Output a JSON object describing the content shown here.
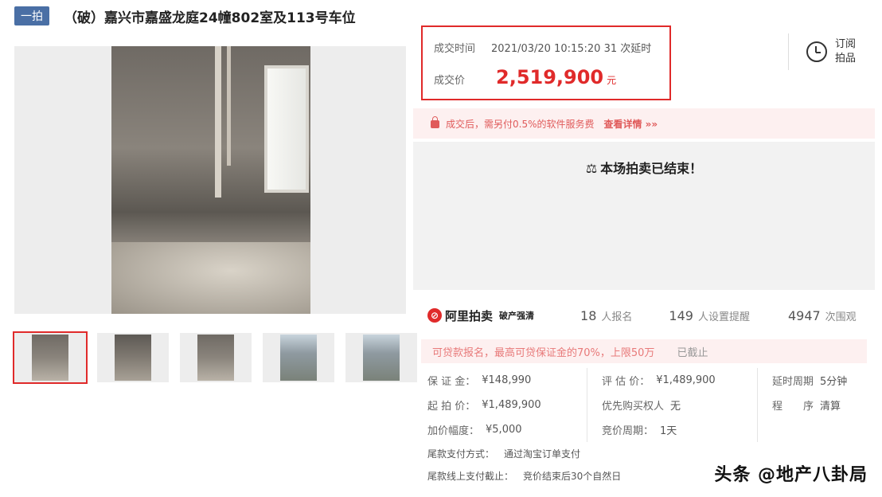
{
  "header": {
    "tag": "一拍",
    "title": "（破）嘉兴市嘉盛龙庭24幢802室及113号车位"
  },
  "deal": {
    "time_label": "成交时间",
    "time_value": "2021/03/20 10:15:20 31 次延时",
    "price_label": "成交价",
    "price_value": "2,519,900",
    "price_unit": "元"
  },
  "subscribe": {
    "label": "订阅拍品"
  },
  "notice": {
    "text": "成交后，需另付0.5%的软件服务费",
    "detail_link": "查看详情 »»"
  },
  "status": {
    "ended_text": "本场拍卖已结束！"
  },
  "brand": {
    "logo_char": "⊘",
    "name": "阿里拍卖",
    "sub": "破产强清"
  },
  "stats": {
    "signups_count": "18",
    "signups_label": "人报名",
    "reminders_count": "149",
    "reminders_label": "人设置提醒",
    "views_count": "4947",
    "views_label": "次围观"
  },
  "deposit_note": {
    "text": "可贷款报名，最高可贷保证金的70%，上限50万",
    "status": "已截止"
  },
  "info": {
    "row1": {
      "c1_label": "保 证 金：",
      "c1_value": "¥148,990",
      "c2_label": "评 估 价：",
      "c2_value": "¥1,489,900",
      "c3_label": "延时周期",
      "c3_value": "5分钟"
    },
    "row2": {
      "c1_label": "起 拍 价：",
      "c1_value": "¥1,489,900",
      "c2_label": "优先购买权人",
      "c2_value": "无",
      "c3_label": "程　　序",
      "c3_value": "清算"
    },
    "row3": {
      "c1_label": "加价幅度：",
      "c1_value": "¥5,000",
      "c2_label": "竞价周期：",
      "c2_value": "1天"
    },
    "payment_method_label": "尾款支付方式：",
    "payment_method_value": "通过淘宝订单支付",
    "payment_deadline_label": "尾款线上支付截止：",
    "payment_deadline_value": "竞价结束后30个自然日"
  },
  "watermark": "头条 @地产八卦局",
  "colors": {
    "accent_red": "#e02a2a",
    "tag_blue": "#4a6fa5"
  }
}
